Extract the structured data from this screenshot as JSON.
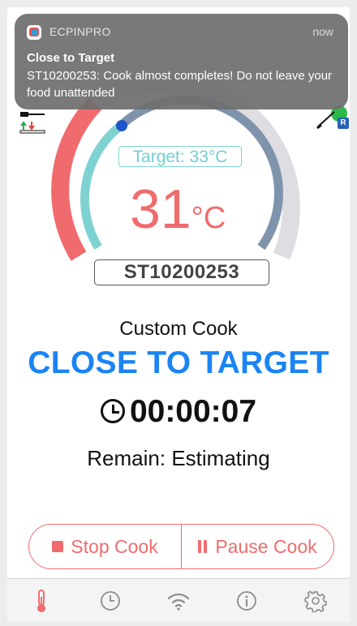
{
  "notification": {
    "app_name": "ECPINPRO",
    "time": "now",
    "title": "Close to Target",
    "body": "ST10200253: Cook almost completes! Do not leave your food unattended"
  },
  "gauge": {
    "target_label": "Target: 33°C",
    "temperature": "31",
    "unit": "°C",
    "probe_id": "ST10200253",
    "progress_fraction": 0.94
  },
  "cook": {
    "mode": "Custom Cook",
    "status": "CLOSE TO TARGET",
    "elapsed": "00:00:07",
    "remain": "Remain: Estimating"
  },
  "buttons": {
    "stop": "Stop Cook",
    "pause": "Pause Cook"
  },
  "badge": "R",
  "tabs": [
    "thermometer-icon",
    "clock-icon",
    "wifi-icon",
    "info-icon",
    "gear-icon"
  ],
  "colors": {
    "accent_red": "#f06b6d",
    "accent_teal": "#7ed3d2",
    "status_blue": "#1a84f4",
    "gauge_track": "#dedee2",
    "gauge_progress": "#7f93ac"
  }
}
